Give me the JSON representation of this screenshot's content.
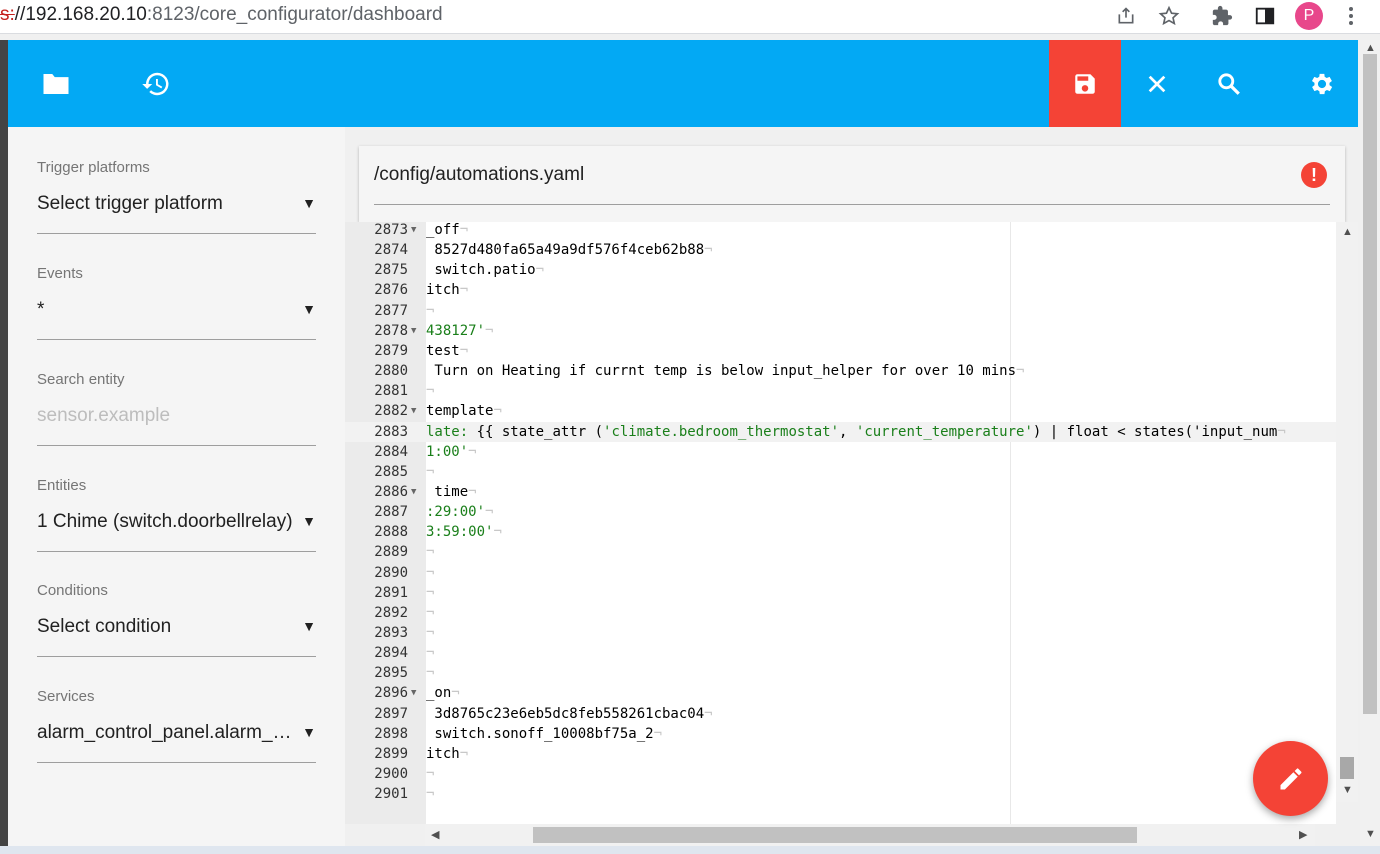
{
  "browser": {
    "url_proto": "s:",
    "url_host": "//192.168.20.10",
    "url_rest": ":8123/core_configurator/dashboard",
    "profile_initial": "P",
    "icons": [
      "share-icon",
      "star-icon",
      "extensions-icon",
      "sidepanel-icon",
      "profile-avatar",
      "more-icon"
    ]
  },
  "toolbar": {
    "buttons": [
      "folder-icon",
      "history-icon",
      "save-icon",
      "close-icon",
      "search-icon",
      "settings-icon"
    ],
    "colors": {
      "bar": "#03a9f4",
      "save_bg": "#f44336"
    }
  },
  "sidebar": {
    "fields": [
      {
        "label": "Trigger platforms",
        "value": "Select trigger platform",
        "dropdown": true,
        "placeholder": false
      },
      {
        "label": "Events",
        "value": "*",
        "dropdown": true,
        "placeholder": false
      },
      {
        "label": "Search entity",
        "value": "sensor.example",
        "dropdown": false,
        "placeholder": true
      },
      {
        "label": "Entities",
        "value": "1 Chime (switch.doorbellrelay)",
        "dropdown": true,
        "placeholder": false
      },
      {
        "label": "Conditions",
        "value": "Select condition",
        "dropdown": true,
        "placeholder": false
      },
      {
        "label": "Services",
        "value": "alarm_control_panel.alarm_arm_away",
        "dropdown": true,
        "placeholder": false
      }
    ]
  },
  "file": {
    "path": "/config/automations.yaml",
    "error_glyph": "!"
  },
  "editor": {
    "active_line": 2883,
    "lines": [
      {
        "n": "2873",
        "fold": true,
        "parts": [
          [
            "t",
            "_off"
          ]
        ]
      },
      {
        "n": "2874",
        "fold": false,
        "parts": [
          [
            "t",
            " 8527d480fa65a49a9df576f4ceb62b88"
          ]
        ]
      },
      {
        "n": "2875",
        "fold": false,
        "parts": [
          [
            "t",
            " switch.patio"
          ]
        ]
      },
      {
        "n": "2876",
        "fold": false,
        "parts": [
          [
            "t",
            "itch"
          ]
        ]
      },
      {
        "n": "2877",
        "fold": false,
        "parts": []
      },
      {
        "n": "2878",
        "fold": true,
        "parts": [
          [
            "s",
            "438127'"
          ]
        ]
      },
      {
        "n": "2879",
        "fold": false,
        "parts": [
          [
            "t",
            "test"
          ]
        ]
      },
      {
        "n": "2880",
        "fold": false,
        "parts": [
          [
            "t",
            " Turn on Heating if currnt temp is below input_helper for over 10 mins"
          ]
        ]
      },
      {
        "n": "2881",
        "fold": false,
        "parts": []
      },
      {
        "n": "2882",
        "fold": true,
        "parts": [
          [
            "t",
            "template"
          ]
        ]
      },
      {
        "n": "2883",
        "fold": false,
        "parts": [
          [
            "s",
            "late:"
          ],
          [
            "t",
            " {{ state_attr ("
          ],
          [
            "s",
            "'climate.bedroom_thermostat'"
          ],
          [
            "t",
            ", "
          ],
          [
            "s",
            "'current_temperature'"
          ],
          [
            "t",
            ") | float < states('input_num"
          ]
        ]
      },
      {
        "n": "2884",
        "fold": false,
        "parts": [
          [
            "s",
            "1:00'"
          ]
        ]
      },
      {
        "n": "2885",
        "fold": false,
        "parts": []
      },
      {
        "n": "2886",
        "fold": true,
        "parts": [
          [
            "t",
            " time"
          ]
        ]
      },
      {
        "n": "2887",
        "fold": false,
        "parts": [
          [
            "s",
            ":29:00'"
          ]
        ]
      },
      {
        "n": "2888",
        "fold": false,
        "parts": [
          [
            "s",
            "3:59:00'"
          ]
        ]
      },
      {
        "n": "2889",
        "fold": false,
        "parts": []
      },
      {
        "n": "2890",
        "fold": false,
        "parts": []
      },
      {
        "n": "2891",
        "fold": false,
        "parts": []
      },
      {
        "n": "2892",
        "fold": false,
        "parts": []
      },
      {
        "n": "2893",
        "fold": false,
        "parts": []
      },
      {
        "n": "2894",
        "fold": false,
        "parts": []
      },
      {
        "n": "2895",
        "fold": false,
        "parts": []
      },
      {
        "n": "2896",
        "fold": true,
        "parts": [
          [
            "t",
            "_on"
          ]
        ]
      },
      {
        "n": "2897",
        "fold": false,
        "parts": [
          [
            "t",
            " 3d8765c23e6eb5dc8feb558261cbac04"
          ]
        ]
      },
      {
        "n": "2898",
        "fold": false,
        "parts": [
          [
            "t",
            " switch.sonoff_10008bf75a_2"
          ]
        ]
      },
      {
        "n": "2899",
        "fold": false,
        "parts": [
          [
            "t",
            "itch"
          ]
        ]
      },
      {
        "n": "2900",
        "fold": false,
        "parts": []
      },
      {
        "n": "2901",
        "fold": false,
        "parts": []
      }
    ]
  },
  "fab": {
    "icon": "edit-icon",
    "color": "#f44336"
  }
}
